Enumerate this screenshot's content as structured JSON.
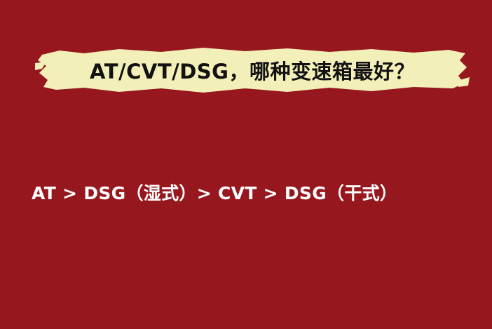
{
  "title": "AT/CVT/DSG，哪种变速箱最好？",
  "ranking": "AT > DSG（湿式）> CVT > DSG（干式）",
  "colors": {
    "background": "#97171e",
    "banner": "#f2efb9",
    "title_text": "#121212",
    "ranking_text": "#ffffff"
  }
}
